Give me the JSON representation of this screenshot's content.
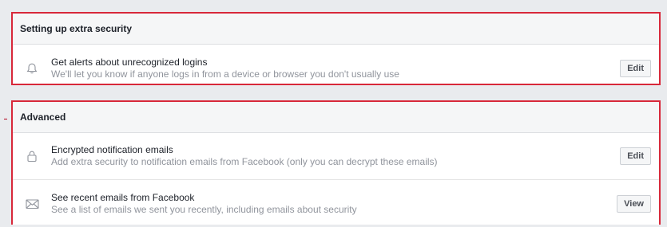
{
  "sections": [
    {
      "title": "Setting up extra security",
      "rows": [
        {
          "icon": "bell-icon",
          "title": "Get alerts about unrecognized logins",
          "subtitle": "We'll let you know if anyone logs in from a device or browser you don't usually use",
          "action": "Edit"
        }
      ]
    },
    {
      "title": "Advanced",
      "rows": [
        {
          "icon": "lock-icon",
          "title": "Encrypted notification emails",
          "subtitle": "Add extra security to notification emails from Facebook (only you can decrypt these emails)",
          "action": "Edit"
        },
        {
          "icon": "envelope-icon",
          "title": "See recent emails from Facebook",
          "subtitle": "See a list of emails we sent you recently, including emails about security",
          "action": "View"
        }
      ]
    }
  ],
  "colors": {
    "highlight_border": "#d8283a",
    "page_background": "#e9ebee",
    "header_background": "#f5f6f7",
    "subtitle_text": "#90949c"
  }
}
